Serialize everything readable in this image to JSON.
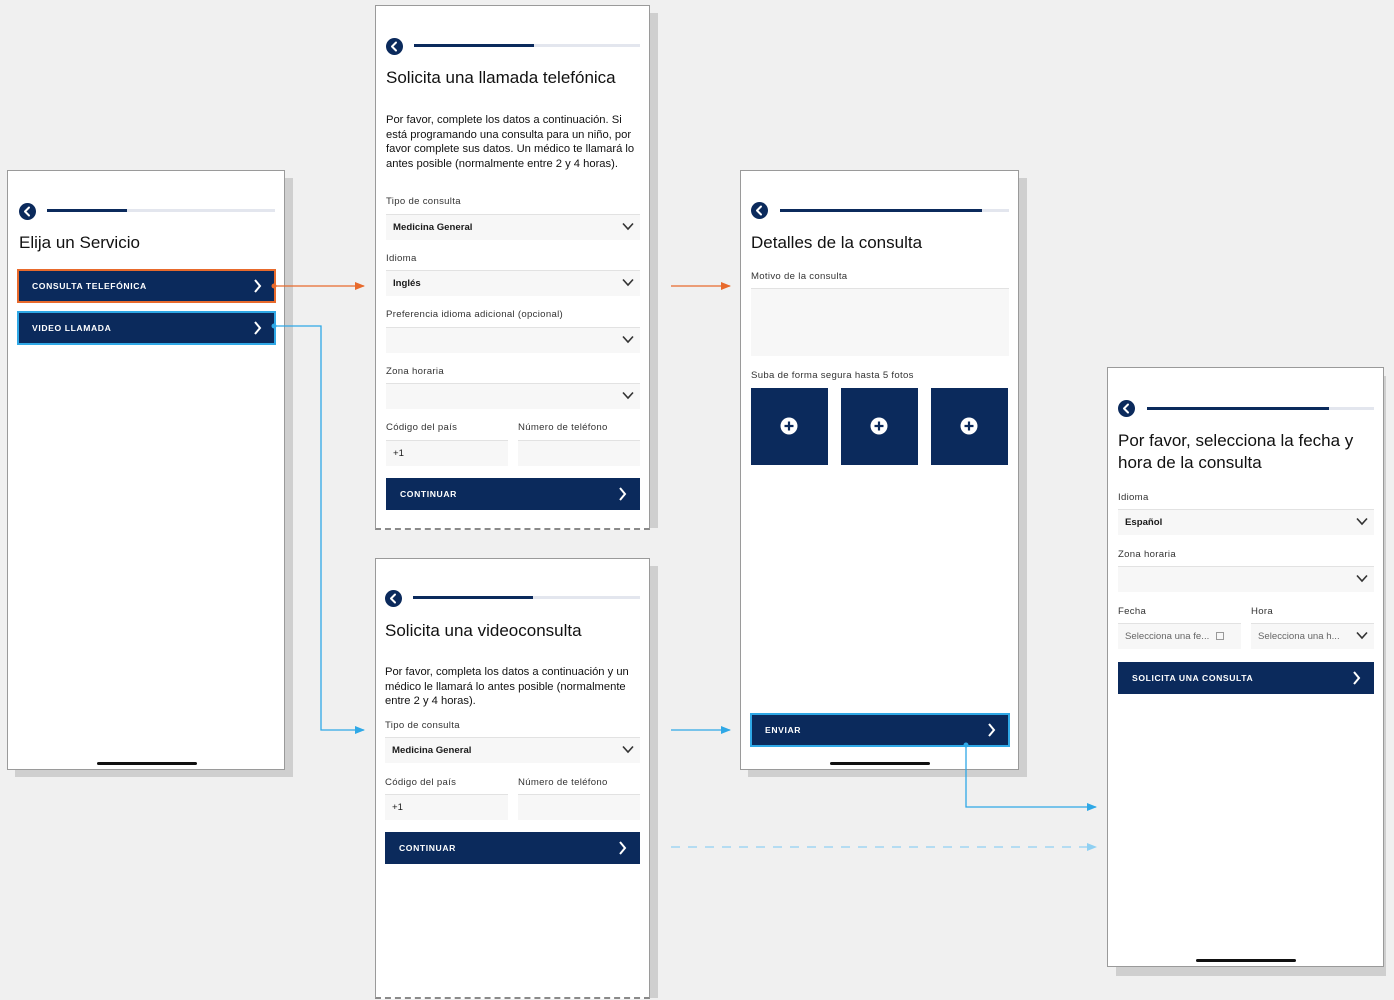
{
  "colors": {
    "brand_navy": "#0b2a5c",
    "arrow_orange": "#e86a2c",
    "arrow_blue": "#2fa8e6",
    "arrow_light_blue": "#8fd0f2"
  },
  "icons": {
    "back": "chevron-left-circle-icon",
    "dropdown": "chevron-down-icon",
    "next": "chevron-right-icon",
    "add_photo": "plus-circle-icon",
    "date_picker": "calendar-icon"
  },
  "screen1": {
    "progress": 0.35,
    "title": "Elija un Servicio",
    "options": [
      {
        "label": "CONSULTA TELEFÓNICA"
      },
      {
        "label": "VIDEO LLAMADA"
      }
    ]
  },
  "screen2": {
    "progress": 0.53,
    "title": "Solicita una llamada telefónica",
    "intro": "Por favor, complete los datos a continuación. Si está programando una consulta para un niño, por favor complete sus datos. Un médico te llamará lo antes posible (normalmente entre 2 y 4 horas).",
    "fields": {
      "consult_type": {
        "label": "Tipo de consulta",
        "value": "Medicina General"
      },
      "language": {
        "label": "Idioma",
        "value": "Inglés"
      },
      "extra_language": {
        "label": "Preferencia idioma adicional (opcional)",
        "value": ""
      },
      "timezone": {
        "label": "Zona horaria",
        "value": ""
      },
      "country_code": {
        "label": "Código del país",
        "value": "+1"
      },
      "phone": {
        "label": "Número de teléfono",
        "value": ""
      }
    },
    "continue_label": "CONTINUAR"
  },
  "screen3": {
    "progress": 0.53,
    "title": "Solicita una videoconsulta",
    "intro": "Por favor, completa los datos a continuación y un médico le llamará lo antes posible (normalmente entre 2 y 4 horas).",
    "fields": {
      "consult_type": {
        "label": "Tipo de consulta",
        "value": "Medicina General"
      },
      "country_code": {
        "label": "Código del país",
        "value": "+1"
      },
      "phone": {
        "label": "Número de teléfono",
        "value": ""
      }
    },
    "continue_label": "CONTINUAR"
  },
  "screen4": {
    "progress": 0.88,
    "title": "Detalles de la consulta",
    "reason_label": "Motivo de la consulta",
    "reason_value": "",
    "photos_label": "Suba de forma segura hasta 5 fotos",
    "photo_slots": 3,
    "submit_label": "ENVIAR"
  },
  "screen5": {
    "progress": 0.8,
    "title": "Por favor, selecciona la fecha y hora de la consulta",
    "fields": {
      "language": {
        "label": "Idioma",
        "value": "Español"
      },
      "timezone": {
        "label": "Zona horaria",
        "value": ""
      },
      "date": {
        "label": "Fecha",
        "placeholder": "Selecciona una fe..."
      },
      "time": {
        "label": "Hora",
        "placeholder": "Selecciona una h..."
      }
    },
    "request_label": "SOLICITA UNA CONSULTA"
  }
}
